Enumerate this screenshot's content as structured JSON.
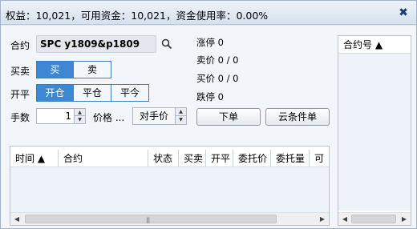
{
  "title": "权益：10,021，可用资金：10,021，资金使用率：0.00%",
  "close_glyph": "✖",
  "labels": {
    "contract": "合约",
    "direction": "买卖",
    "offset": "开平",
    "quantity": "手数",
    "price": "价格 ..."
  },
  "contract_value": "SPC y1809&p1809",
  "direction_options": [
    "买",
    "卖"
  ],
  "direction_selected": "买",
  "offset_options": [
    "开仓",
    "平仓",
    "平今"
  ],
  "offset_selected": "开仓",
  "quantity_value": "1",
  "price_value": "对手价",
  "buttons": {
    "place_order": "下单",
    "cloud_order": "云条件单"
  },
  "quote": {
    "limit_up": "涨停 0",
    "ask": "卖价 0 / 0",
    "bid": "买价 0 / 0",
    "limit_down": "跌停 0"
  },
  "orders_table": {
    "columns": [
      "时间 ▲",
      "合约",
      "状态",
      "买卖",
      "开平",
      "委托价",
      "委托量",
      "可"
    ],
    "rows": []
  },
  "contract_list": {
    "header": "合约号 ▲",
    "rows": []
  },
  "icons": {
    "search": "search-icon",
    "close": "close-icon"
  },
  "colors": {
    "accent": "#3d87d4"
  }
}
